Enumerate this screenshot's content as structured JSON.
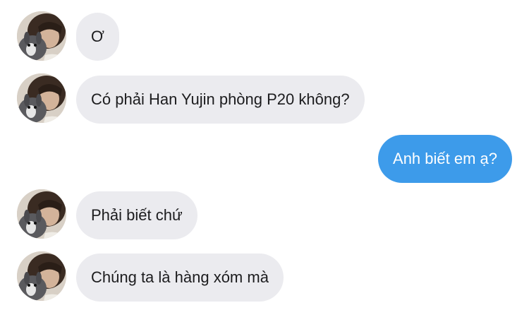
{
  "messages": [
    {
      "sender": "other",
      "text": "Ơ"
    },
    {
      "sender": "other",
      "text": "Có phải Han Yujin phòng P20 không?"
    },
    {
      "sender": "self",
      "text": "Anh biết em ạ?"
    },
    {
      "sender": "other",
      "text": "Phải biết chứ"
    },
    {
      "sender": "other",
      "text": "Chúng ta là hàng xóm mà"
    }
  ],
  "colors": {
    "incoming_bubble": "#ebebef",
    "outgoing_bubble": "#3d9bea",
    "incoming_text": "#1c1c1e",
    "outgoing_text": "#ffffff"
  },
  "icons": {
    "avatar": "contact-photo"
  }
}
